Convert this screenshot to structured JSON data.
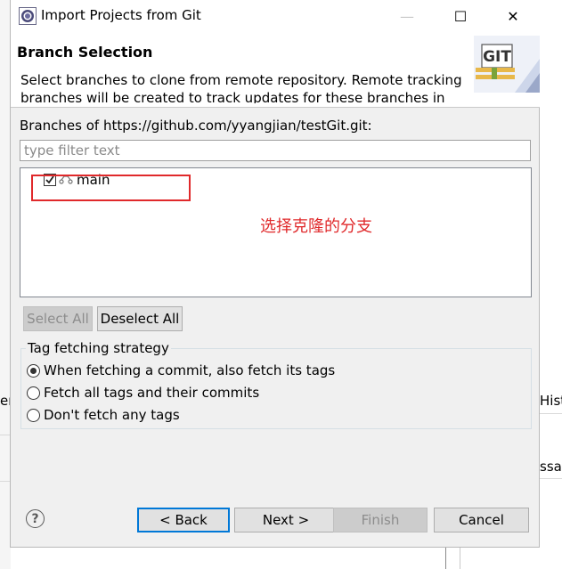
{
  "window": {
    "title": "Import Projects from Git",
    "minimize_glyph": "—",
    "maximize_glyph": "☐",
    "close_glyph": "✕"
  },
  "header": {
    "title": "Branch Selection",
    "description": "Select branches to clone from remote repository. Remote tracking branches will be created to track updates for these branches in the remote repository.",
    "logo_text": "GIT"
  },
  "branches": {
    "label": "Branches of https://github.com/yyangjian/testGit.git:",
    "filter_placeholder": "type filter text",
    "items": [
      {
        "label": "main",
        "checked": true
      }
    ]
  },
  "annotation": {
    "text": "选择克隆的分支",
    "color": "#e0292b"
  },
  "selection_buttons": {
    "select_all": "Select All",
    "deselect_all": "Deselect All"
  },
  "tag_strategy": {
    "title": "Tag fetching strategy",
    "options": [
      {
        "label": "When fetching a commit, also fetch its tags",
        "selected": true
      },
      {
        "label": "Fetch all tags and their commits",
        "selected": false
      },
      {
        "label": "Don't fetch any tags",
        "selected": false
      }
    ]
  },
  "footer": {
    "help_glyph": "?",
    "back": "< Back",
    "next": "Next >",
    "finish": "Finish",
    "cancel": "Cancel"
  },
  "background": {
    "left_fragment": "er",
    "right_fragment_1": "Hist",
    "right_fragment_2": "ssag"
  }
}
